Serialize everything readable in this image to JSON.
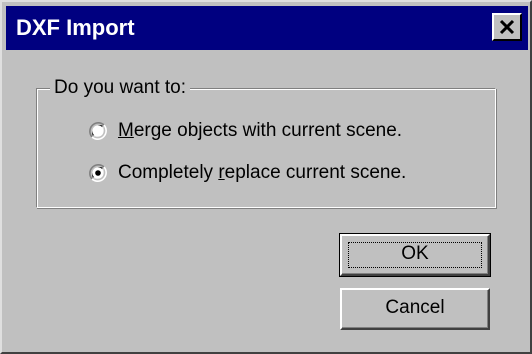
{
  "window": {
    "title": "DXF Import",
    "close_icon": "close-icon"
  },
  "group": {
    "legend": "Do you want to:",
    "options": [
      {
        "prefix": "",
        "accel": "M",
        "rest": "erge objects with current scene.",
        "selected": false
      },
      {
        "prefix": "Completely ",
        "accel": "r",
        "rest": "eplace current scene.",
        "selected": true
      }
    ]
  },
  "buttons": {
    "ok_label": "OK",
    "cancel_label": "Cancel"
  },
  "colors": {
    "titlebar": "#000080",
    "face": "#c0c0c0"
  }
}
